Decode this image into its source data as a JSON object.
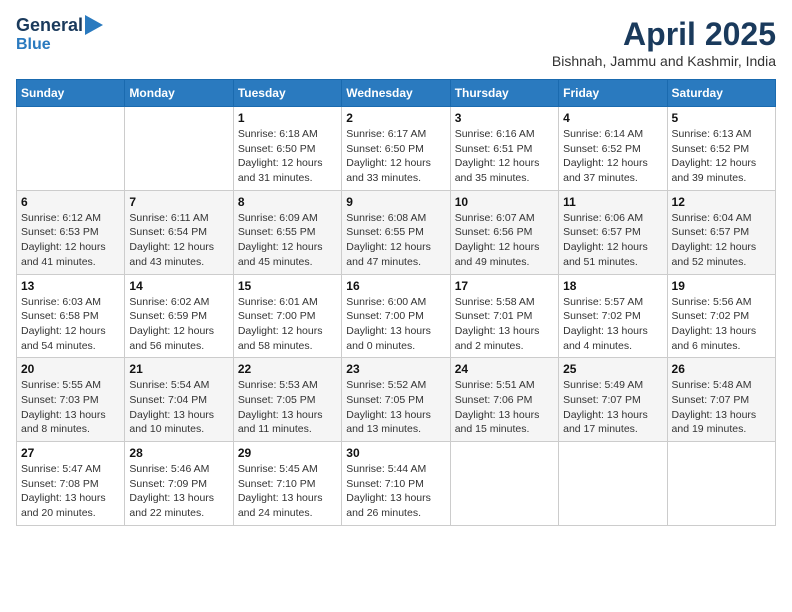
{
  "header": {
    "logo_line1": "General",
    "logo_line2": "Blue",
    "title": "April 2025",
    "subtitle": "Bishnah, Jammu and Kashmir, India"
  },
  "days_of_week": [
    "Sunday",
    "Monday",
    "Tuesday",
    "Wednesday",
    "Thursday",
    "Friday",
    "Saturday"
  ],
  "weeks": [
    [
      {
        "day": "",
        "info": ""
      },
      {
        "day": "",
        "info": ""
      },
      {
        "day": "1",
        "info": "Sunrise: 6:18 AM\nSunset: 6:50 PM\nDaylight: 12 hours\nand 31 minutes."
      },
      {
        "day": "2",
        "info": "Sunrise: 6:17 AM\nSunset: 6:50 PM\nDaylight: 12 hours\nand 33 minutes."
      },
      {
        "day": "3",
        "info": "Sunrise: 6:16 AM\nSunset: 6:51 PM\nDaylight: 12 hours\nand 35 minutes."
      },
      {
        "day": "4",
        "info": "Sunrise: 6:14 AM\nSunset: 6:52 PM\nDaylight: 12 hours\nand 37 minutes."
      },
      {
        "day": "5",
        "info": "Sunrise: 6:13 AM\nSunset: 6:52 PM\nDaylight: 12 hours\nand 39 minutes."
      }
    ],
    [
      {
        "day": "6",
        "info": "Sunrise: 6:12 AM\nSunset: 6:53 PM\nDaylight: 12 hours\nand 41 minutes."
      },
      {
        "day": "7",
        "info": "Sunrise: 6:11 AM\nSunset: 6:54 PM\nDaylight: 12 hours\nand 43 minutes."
      },
      {
        "day": "8",
        "info": "Sunrise: 6:09 AM\nSunset: 6:55 PM\nDaylight: 12 hours\nand 45 minutes."
      },
      {
        "day": "9",
        "info": "Sunrise: 6:08 AM\nSunset: 6:55 PM\nDaylight: 12 hours\nand 47 minutes."
      },
      {
        "day": "10",
        "info": "Sunrise: 6:07 AM\nSunset: 6:56 PM\nDaylight: 12 hours\nand 49 minutes."
      },
      {
        "day": "11",
        "info": "Sunrise: 6:06 AM\nSunset: 6:57 PM\nDaylight: 12 hours\nand 51 minutes."
      },
      {
        "day": "12",
        "info": "Sunrise: 6:04 AM\nSunset: 6:57 PM\nDaylight: 12 hours\nand 52 minutes."
      }
    ],
    [
      {
        "day": "13",
        "info": "Sunrise: 6:03 AM\nSunset: 6:58 PM\nDaylight: 12 hours\nand 54 minutes."
      },
      {
        "day": "14",
        "info": "Sunrise: 6:02 AM\nSunset: 6:59 PM\nDaylight: 12 hours\nand 56 minutes."
      },
      {
        "day": "15",
        "info": "Sunrise: 6:01 AM\nSunset: 7:00 PM\nDaylight: 12 hours\nand 58 minutes."
      },
      {
        "day": "16",
        "info": "Sunrise: 6:00 AM\nSunset: 7:00 PM\nDaylight: 13 hours\nand 0 minutes."
      },
      {
        "day": "17",
        "info": "Sunrise: 5:58 AM\nSunset: 7:01 PM\nDaylight: 13 hours\nand 2 minutes."
      },
      {
        "day": "18",
        "info": "Sunrise: 5:57 AM\nSunset: 7:02 PM\nDaylight: 13 hours\nand 4 minutes."
      },
      {
        "day": "19",
        "info": "Sunrise: 5:56 AM\nSunset: 7:02 PM\nDaylight: 13 hours\nand 6 minutes."
      }
    ],
    [
      {
        "day": "20",
        "info": "Sunrise: 5:55 AM\nSunset: 7:03 PM\nDaylight: 13 hours\nand 8 minutes."
      },
      {
        "day": "21",
        "info": "Sunrise: 5:54 AM\nSunset: 7:04 PM\nDaylight: 13 hours\nand 10 minutes."
      },
      {
        "day": "22",
        "info": "Sunrise: 5:53 AM\nSunset: 7:05 PM\nDaylight: 13 hours\nand 11 minutes."
      },
      {
        "day": "23",
        "info": "Sunrise: 5:52 AM\nSunset: 7:05 PM\nDaylight: 13 hours\nand 13 minutes."
      },
      {
        "day": "24",
        "info": "Sunrise: 5:51 AM\nSunset: 7:06 PM\nDaylight: 13 hours\nand 15 minutes."
      },
      {
        "day": "25",
        "info": "Sunrise: 5:49 AM\nSunset: 7:07 PM\nDaylight: 13 hours\nand 17 minutes."
      },
      {
        "day": "26",
        "info": "Sunrise: 5:48 AM\nSunset: 7:07 PM\nDaylight: 13 hours\nand 19 minutes."
      }
    ],
    [
      {
        "day": "27",
        "info": "Sunrise: 5:47 AM\nSunset: 7:08 PM\nDaylight: 13 hours\nand 20 minutes."
      },
      {
        "day": "28",
        "info": "Sunrise: 5:46 AM\nSunset: 7:09 PM\nDaylight: 13 hours\nand 22 minutes."
      },
      {
        "day": "29",
        "info": "Sunrise: 5:45 AM\nSunset: 7:10 PM\nDaylight: 13 hours\nand 24 minutes."
      },
      {
        "day": "30",
        "info": "Sunrise: 5:44 AM\nSunset: 7:10 PM\nDaylight: 13 hours\nand 26 minutes."
      },
      {
        "day": "",
        "info": ""
      },
      {
        "day": "",
        "info": ""
      },
      {
        "day": "",
        "info": ""
      }
    ]
  ]
}
